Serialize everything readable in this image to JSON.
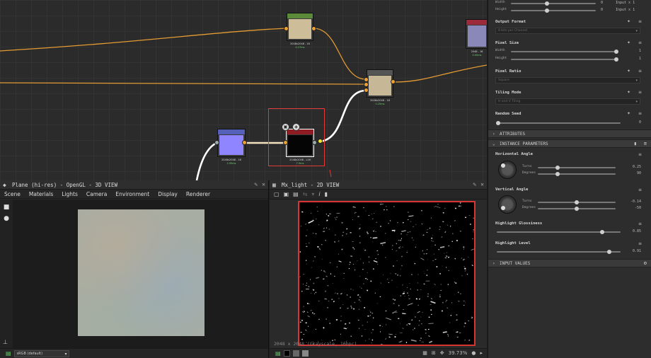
{
  "graph": {
    "nodes": [
      {
        "id": "n_top",
        "res": "2048x2048 - 16",
        "time": "0.27ms"
      },
      {
        "id": "n_blend",
        "res": "2048x2048 - 16",
        "time": "0.25ms"
      },
      {
        "id": "n_blue",
        "res": "2048x2048 - 16",
        "time": "2.95ms"
      },
      {
        "id": "n_selected",
        "res": "2048x2048 - L16",
        "time": "7.9ms"
      },
      {
        "id": "n_right",
        "res": "2048 - 16",
        "time": "0.00ms"
      }
    ]
  },
  "view3d": {
    "title": "Plane (hi-res) - OpenGL - 3D VIEW",
    "menu": [
      "Scene",
      "Materials",
      "Lights",
      "Camera",
      "Environment",
      "Display",
      "Renderer"
    ],
    "colorspace": "sRGB (default)"
  },
  "view2d": {
    "title": "Mx_light - 2D VIEW",
    "resolution_text": "2048 x 2048 (Grayscale, 16bpc)",
    "zoom": "39.73%"
  },
  "params": {
    "width_label": "Width",
    "height_label": "Height",
    "width_top_value": "0",
    "height_top_value": "0",
    "width_top_suffix": "Input x 1",
    "height_top_suffix": "Input x 1",
    "output_format": {
      "label": "Output Format",
      "value": "8 bits per Channel"
    },
    "pixel_size": {
      "label": "Pixel Size",
      "width_value": "1",
      "height_value": "1"
    },
    "pixel_ratio": {
      "label": "Pixel Ratio",
      "value": "Square"
    },
    "tiling_mode": {
      "label": "Tiling Mode",
      "value": "H and V Tiling"
    },
    "random_seed": {
      "label": "Random Seed",
      "value": "0"
    },
    "sections": {
      "attributes": "ATTRIBUTES",
      "instance": "INSTANCE PARAMETERS",
      "inputs": "INPUT VALUES"
    },
    "horizontal_angle": {
      "label": "Horizontal Angle",
      "turns_label": "Turns",
      "degrees_label": "Degrees",
      "turns": 0.25,
      "turns_text": "0.25",
      "degrees": 0.25,
      "degrees_text": "90"
    },
    "vertical_angle": {
      "label": "Vertical Angle",
      "turns_label": "Turns",
      "degrees_label": "Degrees",
      "turns": 0.5,
      "turns_text": "-0.14",
      "degrees": 0.5,
      "degrees_text": "-50"
    },
    "highlight_glossiness": {
      "label": "Highlight Glossiness",
      "value": 0.85,
      "value_text": "0.85"
    },
    "highlight_level": {
      "label": "Highlight Level",
      "value": 0.91,
      "value_text": "0.91"
    }
  }
}
